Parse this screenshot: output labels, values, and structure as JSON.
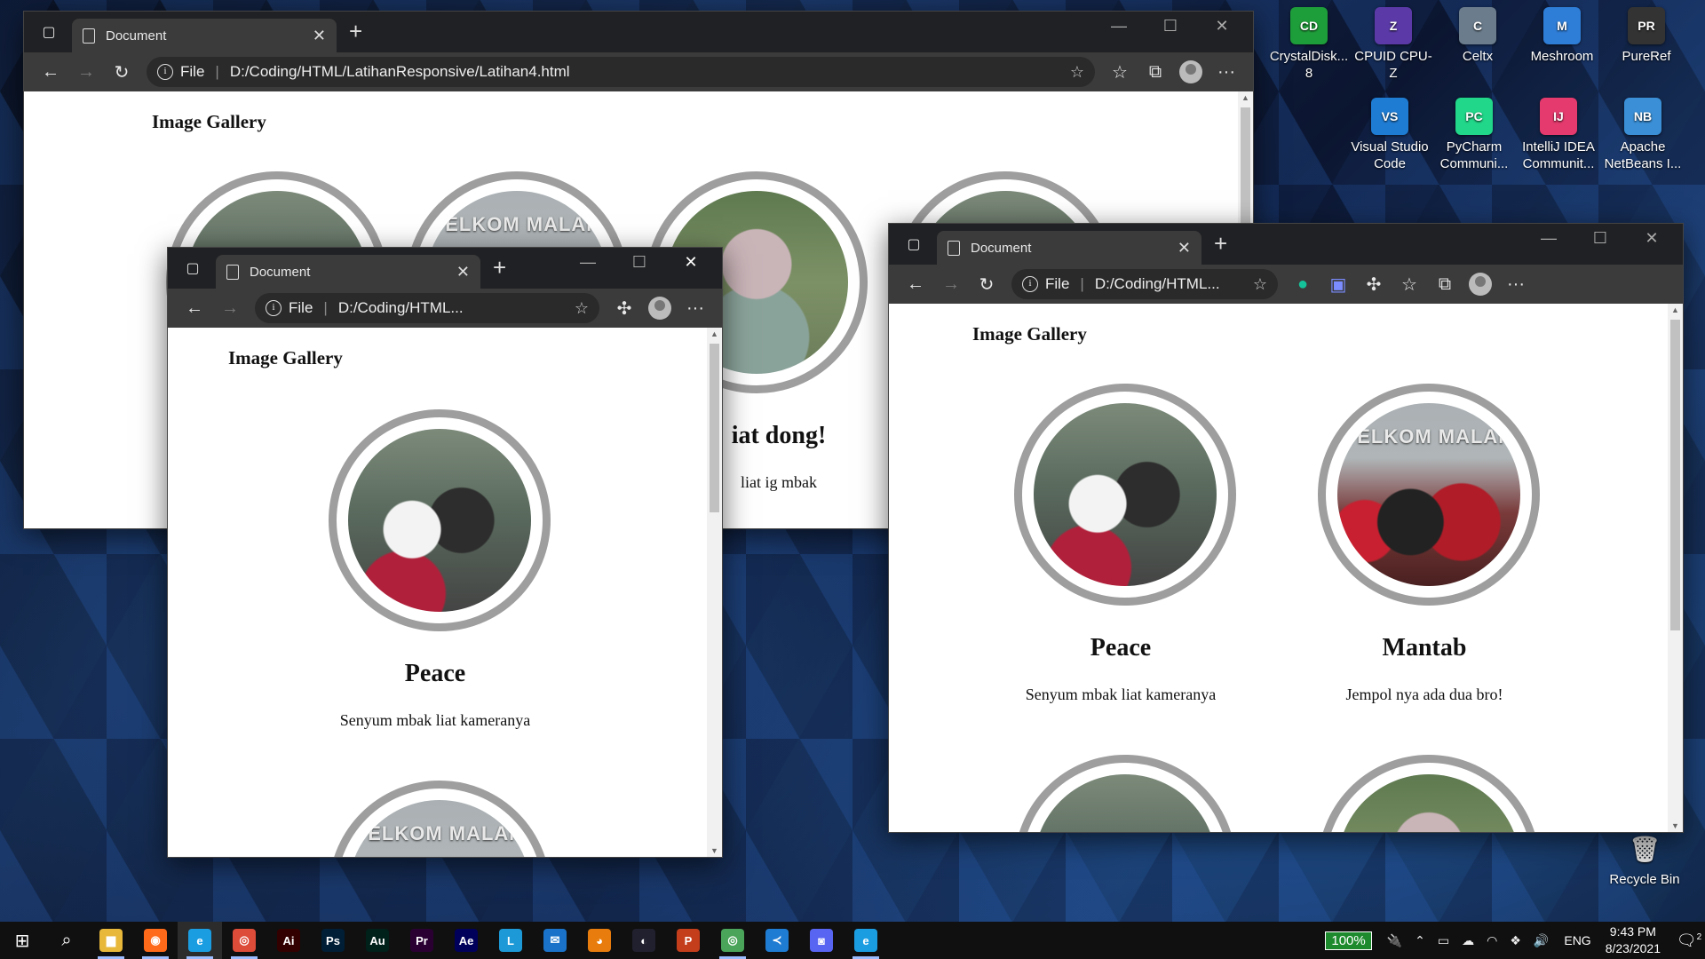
{
  "desktop": {
    "icons_row1": [
      {
        "label": "CrystalDisk... 8",
        "color": "#1e9e3a",
        "glyph": "CD"
      },
      {
        "label": "CPUID CPU-Z",
        "color": "#5b3aa8",
        "glyph": "Z"
      },
      {
        "label": "Celtx",
        "color": "#6b7d8d",
        "glyph": "C"
      },
      {
        "label": "Meshroom",
        "color": "#2e7dd6",
        "glyph": "M"
      },
      {
        "label": "PureRef",
        "color": "#333333",
        "glyph": "PR"
      }
    ],
    "icons_row2": [
      {
        "label": "Visual Studio Code",
        "color": "#1f7cd3",
        "glyph": "VS"
      },
      {
        "label": "PyCharm Communi...",
        "color": "#21d789",
        "glyph": "PC"
      },
      {
        "label": "IntelliJ IDEA Communit...",
        "color": "#e53a6e",
        "glyph": "IJ"
      },
      {
        "label": "Apache NetBeans I...",
        "color": "#3a8fd6",
        "glyph": "NB"
      }
    ],
    "recycle_bin": "Recycle Bin"
  },
  "windows": {
    "back": {
      "tab_title": "Document",
      "url_scheme": "File",
      "url": "D:/Coding/HTML/LatihanResponsive/Latihan4.html",
      "page_title": "Image Gallery",
      "partial_heading": "iat dong!",
      "partial_text": "liat ig mbak"
    },
    "left": {
      "tab_title": "Document",
      "url_scheme": "File",
      "url": "D:/Coding/HTML...",
      "page_title": "Image Gallery",
      "card_title": "Peace",
      "card_text": "Senyum mbak liat kameranya",
      "next_photo_sign": "TELKOM MALAN"
    },
    "right": {
      "tab_title": "Document",
      "url_scheme": "File",
      "url": "D:/Coding/HTML...",
      "page_title": "Image Gallery",
      "cards": [
        {
          "title": "Peace",
          "text": "Senyum mbak liat kameranya"
        },
        {
          "title": "Mantab",
          "text": "Jempol nya ada dua bro!"
        }
      ]
    }
  },
  "photo_sign_text": "TELKOM MALAN",
  "taskbar": {
    "apps": [
      {
        "name": "file-explorer",
        "glyph": "▆",
        "color": "#e8b83a"
      },
      {
        "name": "firefox",
        "glyph": "◉",
        "color": "#ff6a1a"
      },
      {
        "name": "edge",
        "glyph": "e",
        "color": "#1b9de2"
      },
      {
        "name": "chrome",
        "glyph": "◎",
        "color": "#dd4b39"
      },
      {
        "name": "illustrator",
        "glyph": "Ai",
        "color": "#330000"
      },
      {
        "name": "photoshop",
        "glyph": "Ps",
        "color": "#001e36"
      },
      {
        "name": "audition",
        "glyph": "Au",
        "color": "#00201a"
      },
      {
        "name": "premiere",
        "glyph": "Pr",
        "color": "#2a0033"
      },
      {
        "name": "after-effects",
        "glyph": "Ae",
        "color": "#00005b"
      },
      {
        "name": "libreoffice",
        "glyph": "L",
        "color": "#1c99d6"
      },
      {
        "name": "mail",
        "glyph": "✉",
        "color": "#1a73c9"
      },
      {
        "name": "blender",
        "glyph": "◕",
        "color": "#e87d0d"
      },
      {
        "name": "cinema4d",
        "glyph": "◐",
        "color": "#20202f"
      },
      {
        "name": "powerpoint",
        "glyph": "P",
        "color": "#c43e1c"
      },
      {
        "name": "chrome-profile",
        "glyph": "◎",
        "color": "#4aa45a"
      },
      {
        "name": "vscode",
        "glyph": "≺",
        "color": "#1f7cd3"
      },
      {
        "name": "discord",
        "glyph": "◙",
        "color": "#5865f2"
      },
      {
        "name": "edge-2",
        "glyph": "e",
        "color": "#1b9de2"
      }
    ],
    "battery": "100%",
    "language": "ENG",
    "time": "9:43 PM",
    "date": "8/23/2021",
    "notification_count": "2"
  }
}
